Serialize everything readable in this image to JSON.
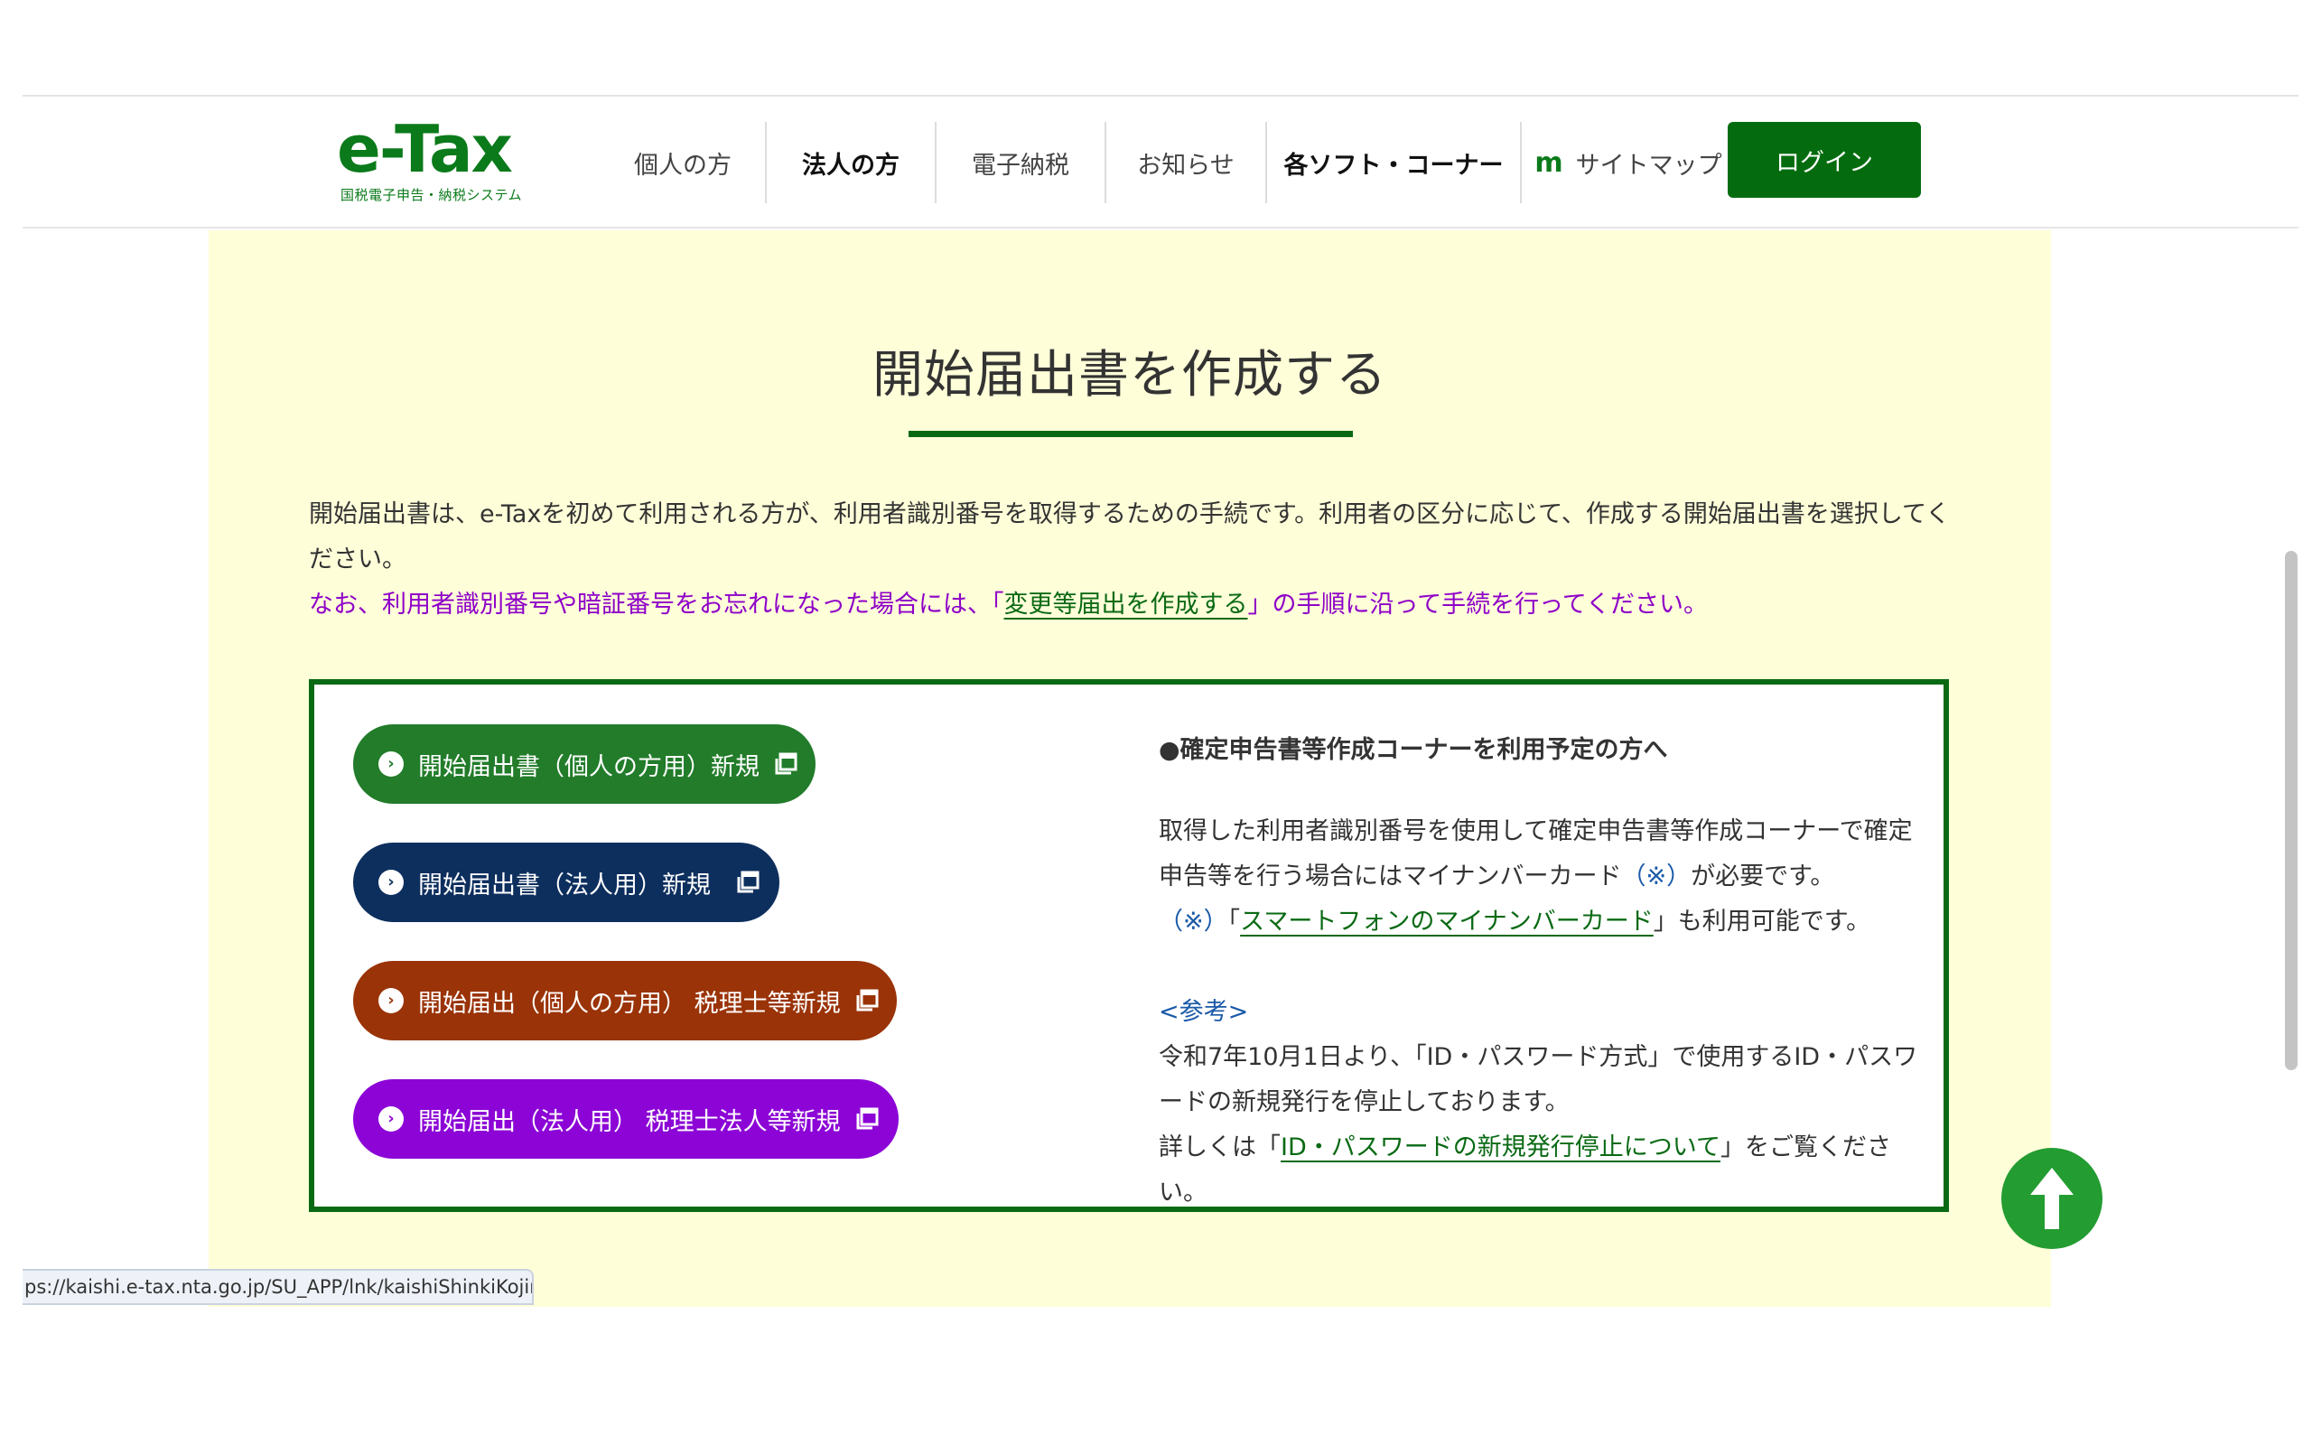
{
  "header": {
    "logo_text": "e-Tax",
    "logo_subtitle": "国税電子申告・納税システム",
    "nav": [
      {
        "label": "個人の方"
      },
      {
        "label": "法人の方"
      },
      {
        "label": "電子納税"
      },
      {
        "label": "お知らせ"
      },
      {
        "label": "各ソフト・コーナー"
      },
      {
        "label": "サイトマップ"
      }
    ],
    "login_label": "ログイン"
  },
  "main": {
    "title": "開始届出書を作成する",
    "intro": "開始届出書は、e-Taxを初めて利用される方が、利用者識別番号を取得するための手続です。利用者の区分に応じて、作成する開始届出書を選択してください。",
    "notice_before": "なお、利用者識別番号や暗証番号をお忘れになった場合には、「",
    "notice_link": "変更等届出を作成する",
    "notice_after": "」の手順に沿って手続を行ってください。",
    "buttons": [
      {
        "label": "開始届出書（個人の方用）新規",
        "color": "#227c2a"
      },
      {
        "label": "開始届出書（法人用）新規",
        "color": "#0d2f5e"
      },
      {
        "label": "開始届出（個人の方用） 税理士等新規",
        "color": "#9a3308"
      },
      {
        "label": "開始届出（法人用） 税理士法人等新規",
        "color": "#8c05d6"
      }
    ],
    "info": {
      "heading": "●確定申告書等作成コーナーを利用予定の方へ",
      "p1": "取得した利用者識別番号を使用して確定申告書等作成コーナーで確定申告等を行う場合にはマイナンバーカード",
      "p1_note": "（※）",
      "p1_end": "が必要です。",
      "p2_note": "（※）",
      "p2_before": "「",
      "p2_link": "スマートフォンのマイナンバーカード",
      "p2_after": "」も利用可能です。",
      "ref_label": "<参考>",
      "p3": "令和7年10月1日より、「ID・パスワード方式」で使用するID・パスワードの新規発行を停止しております。",
      "p4_before": "詳しくは「",
      "p4_link": "ID・パスワードの新規発行停止について",
      "p4_after": "」をご覧ください。"
    }
  },
  "status_url": "ps://kaishi.e-tax.nta.go.jp/SU_APP/lnk/kaishiShinkiKojin",
  "colors": {
    "brand_green": "#0a6a14",
    "content_bg": "#fefed9",
    "notice_purple": "#8e00c8"
  }
}
